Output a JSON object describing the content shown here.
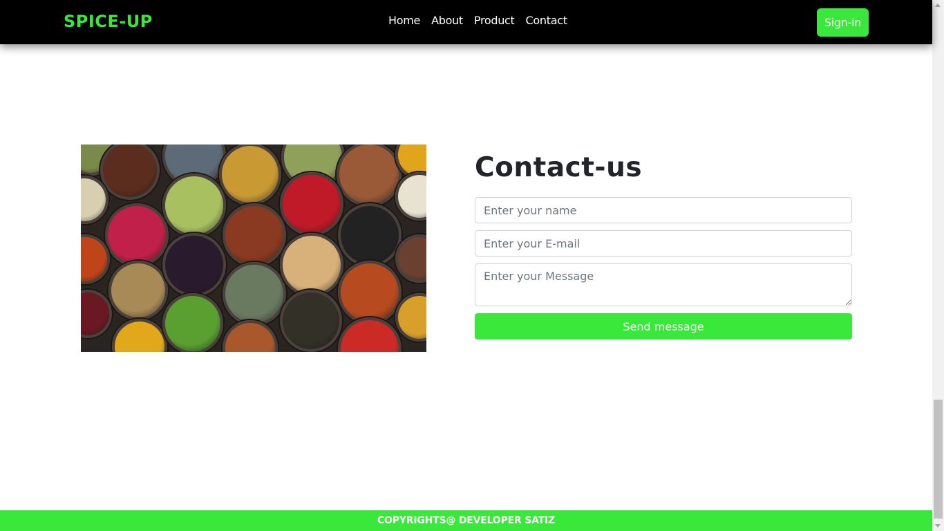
{
  "navbar": {
    "brand": "SPICE-UP",
    "links": [
      "Home",
      "About",
      "Product",
      "Contact"
    ],
    "signin_label": "Sign-in"
  },
  "image": {
    "icon": "spices-photo"
  },
  "contact": {
    "title": "Contact-us",
    "name_placeholder": "Enter your name",
    "email_placeholder": "Enter your E-mail",
    "message_placeholder": "Enter your Message",
    "send_label": "Send message"
  },
  "footer": {
    "text": "COPYRIGHTS@ DEVELOPER SATIZ"
  },
  "colors": {
    "accent": "#39e83a",
    "navbar_bg": "#000000",
    "title": "#212529"
  }
}
